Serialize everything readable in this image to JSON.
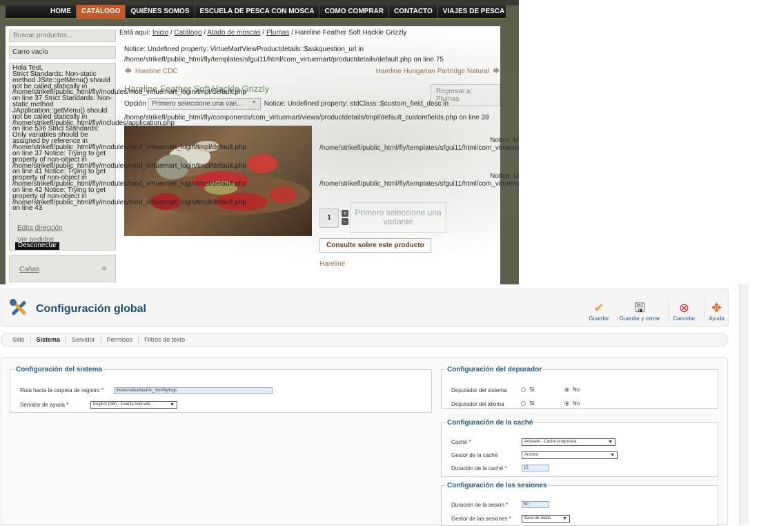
{
  "nav": {
    "items": [
      "HOME",
      "CATÁLOGO",
      "QUIÉNES SOMOS",
      "ESCUELA DE PESCA CON MOSCA",
      "COMO COMPRAR",
      "CONTACTO",
      "VIAJES DE PESCA"
    ],
    "active": 1
  },
  "sidebar": {
    "search_placeholder": "Buscar productos...",
    "cart": "Carro vacío",
    "login_text": "Hola Test,\nStrict Standards: Non-static\nmethod JSite::getMenu() should\nnot be called statically in\n/home/strikefl/public_html/fly/modules/mod_virtuemart_login/tmpl/default.php\non line 37 Strict Standards: Non-\nstatic method\nJApplication::getMenu() should\nnot be called statically in\n/home/strikefl/public_html/fly/includes/application.php\non line 536 Strict Standards:\nOnly variables should be\nassigned by reference in\n/home/strikefl/public_html/fly/modules/mod_virtuemart_login/tmpl/default.php\non line 37 Notice: Trying to get\nproperty of non-object in\n/home/strikefl/public_html/fly/modules/mod_virtuemart_login/tmpl/default.php\non line 41 Notice: Trying to get\nproperty of non-object in\n/home/strikefl/public_html/fly/modules/mod_virtuemart_login/tmpl/default.php\non line 42 Notice: Trying to get\nproperty of non-object in\n/home/strikefl/public_html/fly/modules/mod_virtuemart_login/tmpl/default.php\non line 43",
    "edit_address": "Edita dirección",
    "orders": "Ver pedidos",
    "logout": "Desconectar",
    "category": "Cañas"
  },
  "main": {
    "crumb_prefix": "Está aquí:",
    "crumbs": [
      "Inicio",
      "Catálogo",
      "Atado de moscas",
      "Plumas"
    ],
    "crumb_current": "Hareline Feather Soft Hackle Grizzly",
    "notice1_a": "Notice: Undefined property: VirtueMartViewProductdetails::$askquestion_url in",
    "notice1_b": "/home/strikefl/public_html/fly/templates/sfgui11/html/com_virtuemart/productdetails/default.php on line 75",
    "prev": "Hareline CDC",
    "next": "Hareline Hungarian Partridge Natural",
    "title": "Hareline Feather Soft Hackle Grizzly",
    "back": "Regresar a: Plumas",
    "option_label": "Opción",
    "option_value": "Primero seleccione una vari...",
    "option_notice": "Notice: Undefined property: stdClass::$custom_field_desc in",
    "notice2": "/home/strikefl/public_html/fly/components/com_virtuemart/views/productdetails/tmpl/default_customfields.php on line 39",
    "rnotice_head": "Notice: Und",
    "rnotice_path": "/home/strikefl/public_html/fly/templates/sfgui11/html/com_virtuemart",
    "qty": "1",
    "add_placeholder": "Primero seleccione una variante",
    "ask": "Consulte sobre este producto",
    "manufacturer": "Hareline"
  },
  "admin": {
    "title": "Configuración global",
    "toolbar": [
      "Guardar",
      "Guardar y cerrar",
      "Cancelar",
      "Ayuda"
    ],
    "tabs": [
      "Sitio",
      "Sistema",
      "Servidor",
      "Permisos",
      "Filtros de texto"
    ],
    "active_tab": 1,
    "sys_legend": "Configuración del sistema",
    "log_label": "Ruta hacia la carpeta de registro",
    "log_value": "/home/strikefl/public_html/fly/logs",
    "help_label": "Servidor de ayuda",
    "help_value": "English (GB) - Joomla help wiki",
    "debug_legend": "Configuración del depurador",
    "debug_sys": "Depurador del sistema",
    "debug_lang": "Depurador del idioma",
    "yes": "Sí",
    "no": "No",
    "cache_legend": "Configuración de la caché",
    "cache_label": "Caché",
    "cache_value": "Activado - Caché progresiva",
    "cache_handler_label": "Gestor de la caché",
    "cache_handler_value": "Archivo",
    "cache_time_label": "Duración de la caché",
    "cache_time_value": "15",
    "session_legend": "Configuración de las sesiones",
    "session_time_label": "Duración de la sesión",
    "session_time_value": "60",
    "session_handler_label": "Gestor de las sesiones",
    "session_handler_value": "Base de datos",
    "colors": {
      "brand_blue": "#1e4c6e",
      "legend_blue": "#1e5a8a",
      "nav_active": "#c8582a"
    }
  }
}
